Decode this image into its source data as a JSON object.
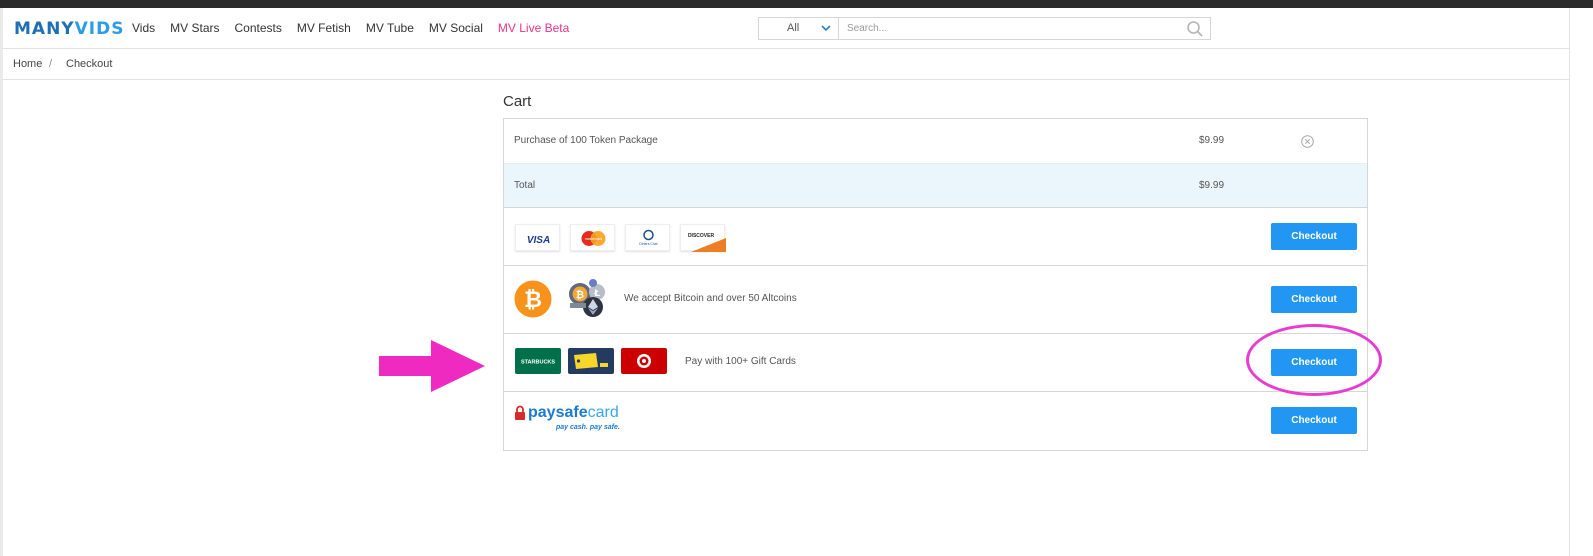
{
  "brand": {
    "name_part1": "MANY",
    "name_part2": "VIDS"
  },
  "nav": {
    "items": [
      "Vids",
      "MV Stars",
      "Contests",
      "MV Fetish",
      "MV Tube",
      "MV Social"
    ],
    "live": "MV Live Beta"
  },
  "search": {
    "filter": "All",
    "placeholder": "Search..."
  },
  "breadcrumb": {
    "home": "Home",
    "separator": "/",
    "current": "Checkout"
  },
  "cart": {
    "title": "Cart",
    "item": {
      "description": "Purchase of 100 Token Package",
      "price": "$9.99"
    },
    "total": {
      "label": "Total",
      "price": "$9.99"
    }
  },
  "payment": {
    "cards": {
      "logos": [
        "VISA",
        "mastercard",
        "Diners Club",
        "DISCOVER"
      ],
      "button": "Checkout"
    },
    "crypto": {
      "text": "We accept Bitcoin and over 50 Altcoins",
      "button": "Checkout"
    },
    "gift": {
      "logos": [
        "STARBUCKS",
        "gift-tag",
        "target"
      ],
      "text": "Pay with 100+ Gift Cards",
      "button": "Checkout"
    },
    "paysafe": {
      "logo_part1": "paysafe",
      "logo_part2": "card",
      "tagline": "pay cash. pay safe.",
      "button": "Checkout"
    }
  },
  "colors": {
    "brand_blue": "#1d6fb8",
    "button_blue": "#2196f3",
    "live_pink": "#e8338d",
    "annotation_magenta": "#e83bd0",
    "total_row_bg": "#eaf5fc"
  }
}
